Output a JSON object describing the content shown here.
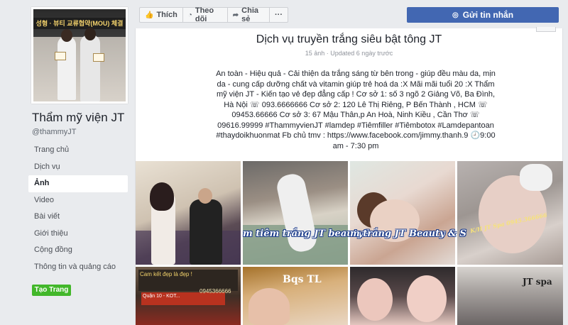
{
  "page": {
    "name": "Thẩm mỹ viện JT",
    "handle": "@thammyJT",
    "profile_banner": "성형 · 뷰티 교류협약(MOU) 체결"
  },
  "sidebar": {
    "items": [
      {
        "label": "Trang chủ",
        "active": false
      },
      {
        "label": "Dịch vụ",
        "active": false
      },
      {
        "label": "Ảnh",
        "active": true
      },
      {
        "label": "Video",
        "active": false
      },
      {
        "label": "Bài viết",
        "active": false
      },
      {
        "label": "Giới thiệu",
        "active": false
      },
      {
        "label": "Cộng đồng",
        "active": false
      },
      {
        "label": "Thông tin và quảng cáo",
        "active": false
      }
    ],
    "create_page_label": "Tạo Trang"
  },
  "actions": {
    "like": "Thích",
    "follow": "Theo dõi",
    "share": "Chia sẻ",
    "more": "···",
    "send_message": "Gửi tin nhắn"
  },
  "album": {
    "title": "Dịch vụ truyền trắng siêu bật tông JT",
    "meta": "15 ảnh · Updated 6 ngày trước",
    "description": "An toàn - Hiệu quả - Cải thiện da trắng sáng từ bên trong - giúp đều màu da, mịn da - cung cấp dưỡng chất và vitamin giúp trẻ hoá da :X Mãi mãi tuổi 20 :X Thẩm mỹ viện JT - Kiến tạo vẻ đẹp đẳng cấp ! Cơ sở 1: số 3 ngõ 2 Giảng Võ, Ba Đình, Hà Nội ☏ 093.6666666 Cơ sở 2: 120 Lê Thị Riêng, P Bến Thành , HCM ☏ 09453.66666 Cơ sở 3: 67 Mậu Thân,p An Hoà, Ninh Kiều , Cần Thơ ☏ 09616.99999 #ThammyvienJT #lamdep #Tiêmfiller #Tiêmbotox #Lamdepantoan #thaydoikhuonmat Fb chủ tmv : https://www.facebook.com/jimmy.thanh.9 🕘9:00 am - 7:30 pm"
  },
  "photos": {
    "watermark_2": "m tiêm trắng JT beauty&",
    "watermark_3": "m trắng JT Beauty & S",
    "watermark_4": "K/H JT Spa 0945.366666",
    "sign_5": "Cam kết đẹp là đẹp !",
    "sign_5_sub": "Quận 10 - KOT...",
    "phone_5": "0945366666",
    "logo_6": "Bqs TL",
    "logo_8": "JT spa"
  },
  "colors": {
    "accent": "#4267b2",
    "create_green": "#42b72a",
    "page_bg": "#e9ebee"
  },
  "icons": {
    "like": "thumbs-up-icon",
    "follow": "rss-icon",
    "share": "share-arrow-icon",
    "message": "messenger-icon"
  }
}
